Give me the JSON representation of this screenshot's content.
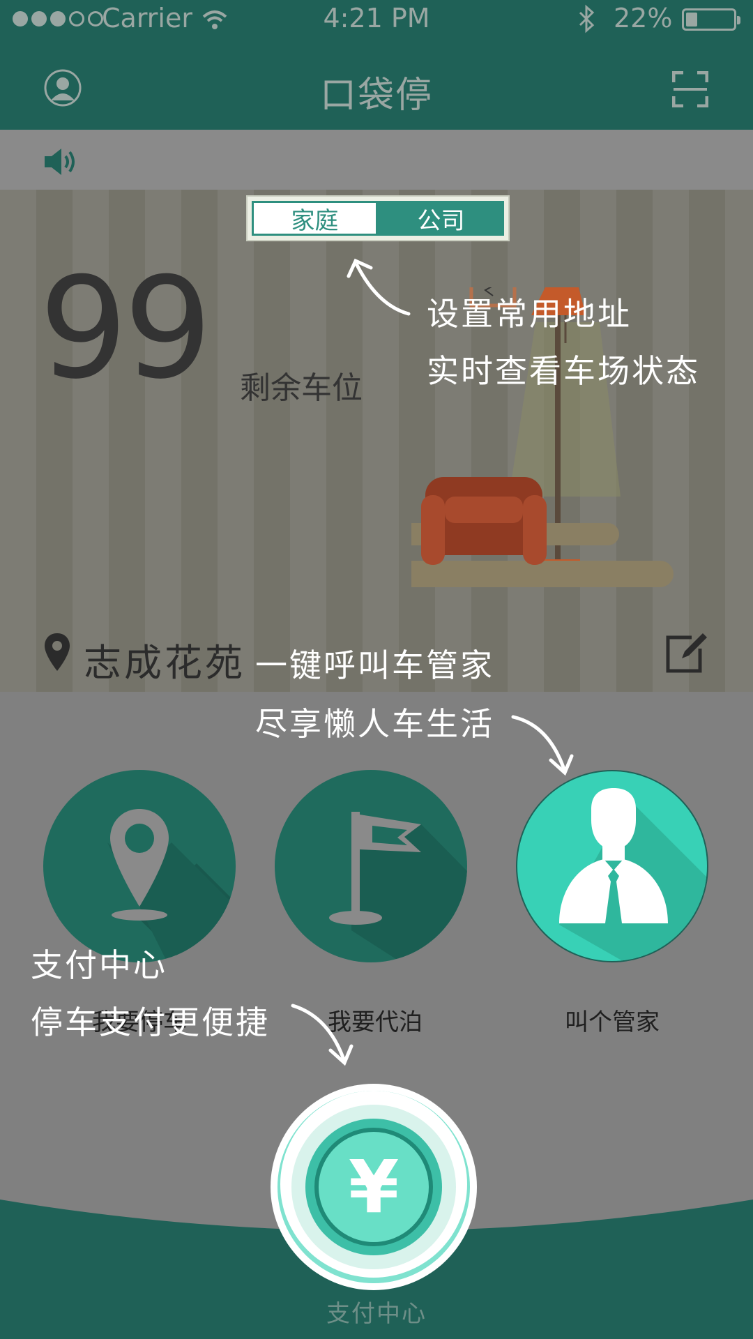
{
  "status_bar": {
    "carrier": "Carrier",
    "time": "4:21 PM",
    "battery": "22%",
    "icons": [
      "signal-dots",
      "wifi-icon",
      "bluetooth-icon",
      "battery-icon"
    ]
  },
  "navbar": {
    "title": "口袋停",
    "left_icon": "user-icon",
    "right_icon": "scan-icon"
  },
  "notice": {
    "icon": "speaker-icon"
  },
  "toggle": {
    "home": "家庭",
    "company": "公司",
    "selected": "公司"
  },
  "parking": {
    "remaining": "99",
    "remaining_label": "剩余车位"
  },
  "location": {
    "name": "志成花苑",
    "pin_icon": "location-pin-icon",
    "edit_icon": "edit-icon"
  },
  "functions": [
    {
      "icon": "location-pin-icon",
      "label": "我要停车"
    },
    {
      "icon": "flag-icon",
      "label": "我要代泊"
    },
    {
      "icon": "butler-icon",
      "label": "叫个管家"
    }
  ],
  "pay": {
    "icon": "yuan-icon",
    "label": "支付中心"
  },
  "annotations": {
    "address_line1": "设置常用地址",
    "address_line2": "实时查看车场状态",
    "butler_line1": "一键呼叫车管家",
    "butler_line2": "尽享懒人车生活",
    "pay_line1": "支付中心",
    "pay_line2": "停车支付更便捷"
  },
  "colors": {
    "primary": "#1f6157",
    "accent": "#38d1b6",
    "overlay": "#808080",
    "text_dark": "#333333"
  }
}
